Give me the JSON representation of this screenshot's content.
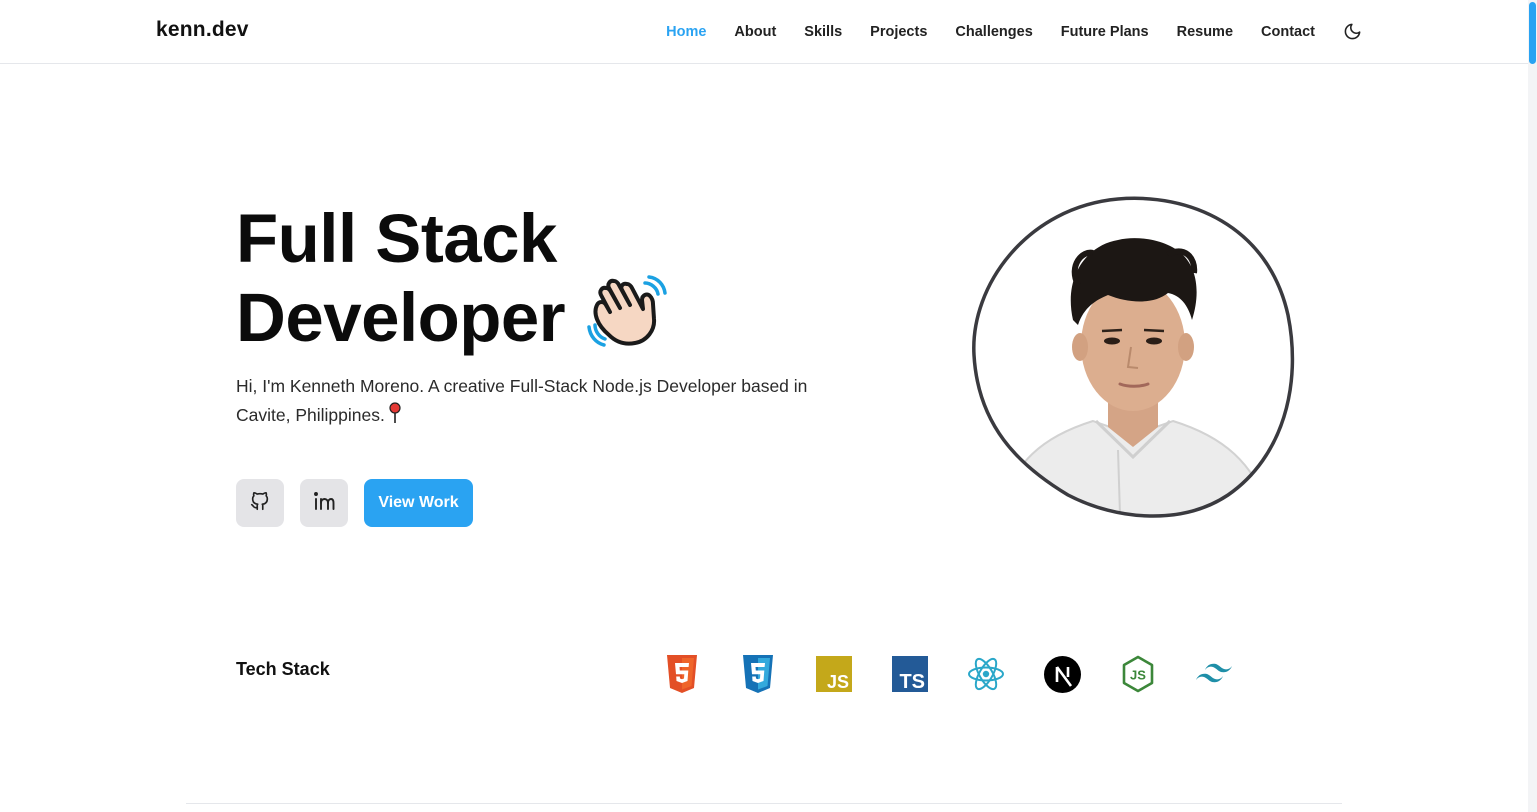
{
  "header": {
    "logo": "kenn.dev",
    "nav": [
      {
        "label": "Home",
        "active": true
      },
      {
        "label": "About"
      },
      {
        "label": "Skills"
      },
      {
        "label": "Projects"
      },
      {
        "label": "Challenges"
      },
      {
        "label": "Future Plans"
      },
      {
        "label": "Resume"
      },
      {
        "label": "Contact"
      }
    ],
    "theme_icon": "moon-icon"
  },
  "hero": {
    "title_line1": "Full Stack",
    "title_line2": "Developer",
    "description": "Hi, I'm Kenneth Moreno. A creative Full-Stack Node.js Developer based in Cavite, Philippines.",
    "cta_label": "View Work",
    "social": [
      {
        "icon": "github-icon"
      },
      {
        "icon": "linkedin-icon"
      }
    ]
  },
  "tech_stack": {
    "label": "Tech Stack",
    "icons": [
      {
        "name": "html5-icon",
        "color": "#e34f26"
      },
      {
        "name": "css3-icon",
        "color": "#1572b6"
      },
      {
        "name": "javascript-icon",
        "color": "#c4a81a"
      },
      {
        "name": "typescript-icon",
        "color": "#235a97"
      },
      {
        "name": "react-icon",
        "color": "#2aa7c9"
      },
      {
        "name": "nextjs-icon",
        "color": "#000000"
      },
      {
        "name": "nodejs-icon",
        "color": "#3c873a"
      },
      {
        "name": "tailwind-icon",
        "color": "#1f8fa8"
      }
    ]
  },
  "colors": {
    "accent": "#2aa3f2",
    "button_gray": "#e4e4e7"
  }
}
